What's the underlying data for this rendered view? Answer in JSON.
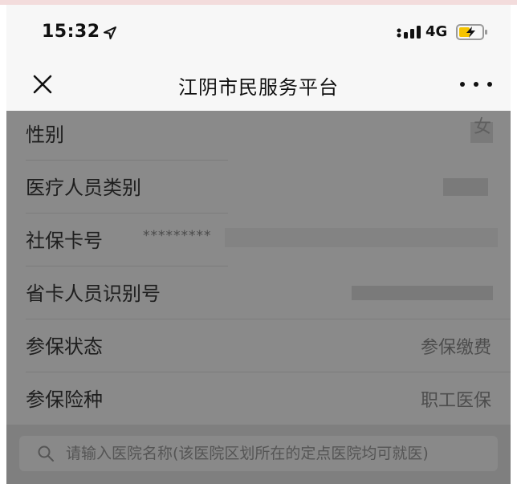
{
  "status_bar": {
    "time": "15:32",
    "network": "4G"
  },
  "nav": {
    "title": "江阴市民服务平台"
  },
  "info_rows": [
    {
      "label": "性别",
      "value": "女"
    },
    {
      "label": "医疗人员类别",
      "value": ""
    },
    {
      "label": "社保卡号",
      "value": "*********"
    },
    {
      "label": "省卡人员识别号",
      "value": ""
    },
    {
      "label": "参保状态",
      "value": "参保缴费"
    },
    {
      "label": "参保险种",
      "value": "职工医保"
    }
  ],
  "search": {
    "placeholder": "请输入医院名称(该医院区划所在的定点医院均可就医)"
  },
  "colors": {
    "overlay": "#8a8a8a",
    "nav_background": "#f7f7f7"
  }
}
